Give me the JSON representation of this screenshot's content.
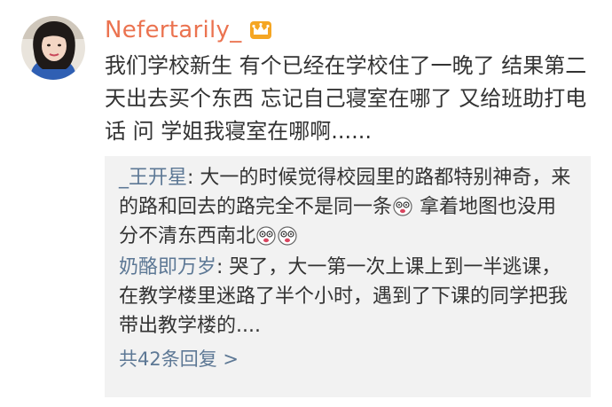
{
  "post": {
    "username": "Nefertarily_",
    "avatar_icon": "user-avatar-photo",
    "badge_icon": "crown-badge-icon",
    "badge_color": "#f5a623",
    "username_color": "#eb7350",
    "text": "我们学校新生 有个已经在学校住了一晚了 结果第二天出去买个东西 忘记自己寝室在哪了 又给班助打电话 问 学姐我寝室在哪啊......"
  },
  "replies": [
    {
      "author": "_王开星",
      "separator": ": ",
      "text_1": "大一的时候觉得校园里的路都特别神奇，来的路和回去的路完全不是同一条",
      "text_2": " 拿着地图也没用 分不清东西南北",
      "emoji": "dizzy-face-emoji"
    },
    {
      "author": "奶酪即万岁",
      "separator": ": ",
      "text": "哭了，大一第一次上课上到一半逃课，在教学楼里迷路了半个小时，遇到了下课的同学把我带出教学楼的...."
    }
  ],
  "more_replies_label": "共42条回复 >",
  "link_color": "#5d7895",
  "reply_box_color": "#f2f2f2"
}
